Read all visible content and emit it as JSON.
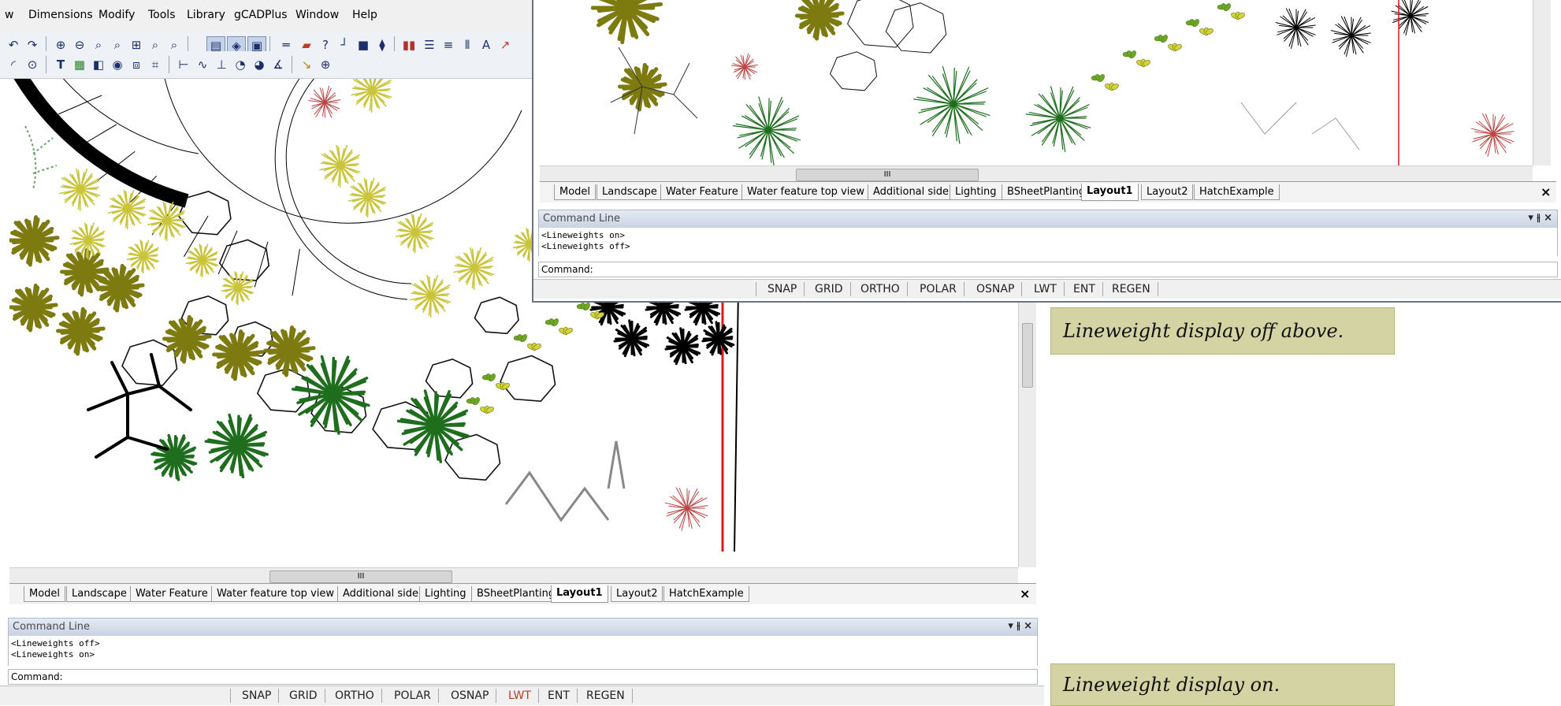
{
  "left_window": {
    "menu": [
      "w",
      "Dimensions",
      "Modify",
      "Tools",
      "Library",
      "gCADPlus",
      "Window",
      "Help"
    ],
    "tabs": [
      "Model",
      "Landscape",
      "Water Feature",
      "Water feature top view",
      "Additional side",
      "Lighting",
      "BSheetPlanting",
      "Layout1",
      "Layout2",
      "HatchExample"
    ],
    "active_tab": "Layout1",
    "hscroll_grip": "III",
    "vscroll_grip": "III",
    "close_glyph": "×",
    "command_line": {
      "title": "Command Line",
      "controls": "▾ ⫲ ×",
      "history": [
        "<Lineweights off>",
        "<Lineweights on>"
      ],
      "prompt": "Command:"
    },
    "status_buttons": [
      "SNAP",
      "GRID",
      "ORTHO",
      "POLAR",
      "OSNAP",
      "LWT",
      "ENT",
      "REGEN"
    ],
    "lwt_active": true
  },
  "right_window": {
    "tabs": [
      "Model",
      "Landscape",
      "Water Feature",
      "Water feature top view",
      "Additional side",
      "Lighting",
      "BSheetPlanting",
      "Layout1",
      "Layout2",
      "HatchExample"
    ],
    "active_tab": "Layout1",
    "hscroll_grip": "III",
    "close_glyph": "×",
    "command_line": {
      "title": "Command Line",
      "controls": "▾ ⫲ ×",
      "history": [
        "<Lineweights on>",
        "<Lineweights off>"
      ],
      "prompt": "Command:"
    },
    "status_buttons": [
      "SNAP",
      "GRID",
      "ORTHO",
      "POLAR",
      "OSNAP",
      "LWT",
      "ENT",
      "REGEN"
    ],
    "lwt_active": false
  },
  "captions": {
    "top": "Lineweight display off above.",
    "bottom": "Lineweight display on."
  },
  "colors": {
    "plant_olive": "#7d7a10",
    "plant_yellow": "#c9c43a",
    "plant_dark_green": "#1e6e1e",
    "boundary_red": "#e01818",
    "caption_bg": "#d3d3a4",
    "lwt_on": "#c0392b"
  }
}
